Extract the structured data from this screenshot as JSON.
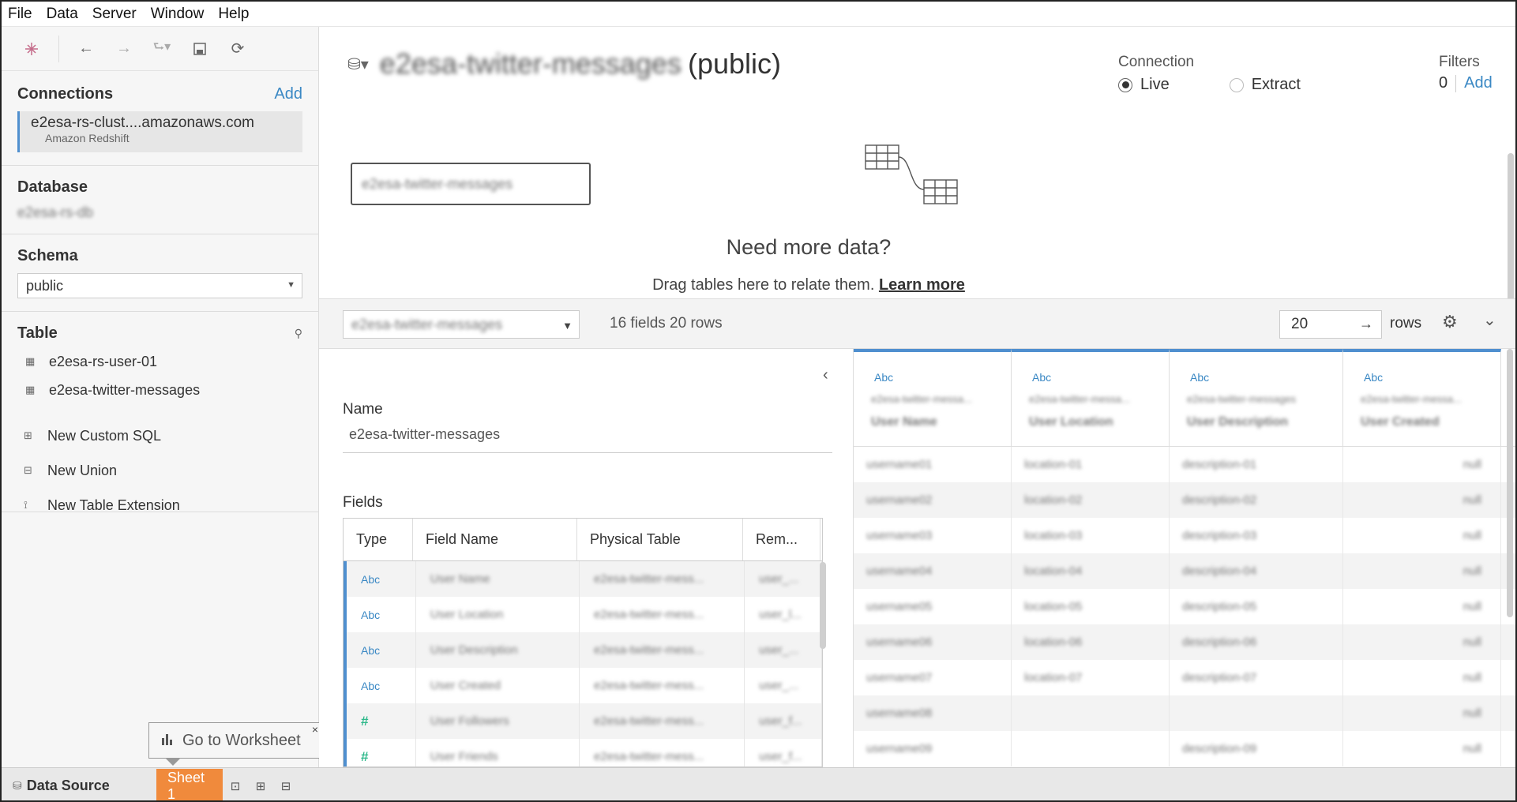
{
  "menu": [
    "File",
    "Data",
    "Server",
    "Window",
    "Help"
  ],
  "toolbar": {
    "icons": [
      "tableau-logo-icon",
      "back-icon",
      "forward-icon",
      "redo-icon",
      "save-icon",
      "refresh-icon"
    ]
  },
  "connections": {
    "title": "Connections",
    "add_label": "Add",
    "server": "e2esa-rs-clust....amazonaws.com",
    "type": "Amazon Redshift"
  },
  "database": {
    "title": "Database",
    "value": "e2esa-rs-db"
  },
  "schema": {
    "title": "Schema",
    "value": "public"
  },
  "table": {
    "title": "Table",
    "items": [
      "e2esa-rs-user-01",
      "e2esa-twitter-messages"
    ],
    "actions": [
      "New Custom SQL",
      "New Union",
      "New Table Extension"
    ]
  },
  "tooltip": {
    "label": "Go to Worksheet",
    "close": "×"
  },
  "bottom_tabs": {
    "data_source": "Data Source",
    "sheet": "Sheet 1"
  },
  "header": {
    "datasource_name": "e2esa-twitter-messages",
    "schema_suffix": "(public)",
    "connection_label": "Connection",
    "live_label": "Live",
    "extract_label": "Extract",
    "filters_label": "Filters",
    "filters_count": "0",
    "filters_add": "Add"
  },
  "canvas": {
    "table_name": "e2esa-twitter-messages",
    "need_title": "Need more data?",
    "need_sub": "Drag tables here to relate them.",
    "learn_more": "Learn more"
  },
  "midbar": {
    "selected_table": "e2esa-twitter-messages",
    "summary": "16 fields 20 rows",
    "rows_value": "20",
    "rows_label": "rows"
  },
  "metadata": {
    "name_label": "Name",
    "name_value": "e2esa-twitter-messages",
    "fields_label": "Fields",
    "columns": [
      "Type",
      "Field Name",
      "Physical Table",
      "Rem..."
    ],
    "rows": [
      {
        "type": "Abc",
        "field": "User Name",
        "table": "e2esa-twitter-mess...",
        "remote": "user_..."
      },
      {
        "type": "Abc",
        "field": "User Location",
        "table": "e2esa-twitter-mess...",
        "remote": "user_l..."
      },
      {
        "type": "Abc",
        "field": "User Description",
        "table": "e2esa-twitter-mess...",
        "remote": "user_..."
      },
      {
        "type": "Abc",
        "field": "User Created",
        "table": "e2esa-twitter-mess...",
        "remote": "user_..."
      },
      {
        "type": "#",
        "field": "User Followers",
        "table": "e2esa-twitter-mess...",
        "remote": "user_f..."
      },
      {
        "type": "#",
        "field": "User Friends",
        "table": "e2esa-twitter-mess...",
        "remote": "user_f..."
      }
    ]
  },
  "grid": {
    "columns": [
      {
        "type": "Abc",
        "table": "e2esa-twitter-messa...",
        "name": "User Name"
      },
      {
        "type": "Abc",
        "table": "e2esa-twitter-messa...",
        "name": "User Location"
      },
      {
        "type": "Abc",
        "table": "e2esa-twitter-messages",
        "name": "User Description"
      },
      {
        "type": "Abc",
        "table": "e2esa-twitter-messa...",
        "name": "User Created"
      }
    ],
    "rows": [
      [
        "username01",
        "location-01",
        "description-01",
        "null"
      ],
      [
        "username02",
        "location-02",
        "description-02",
        "null"
      ],
      [
        "username03",
        "location-03",
        "description-03",
        "null"
      ],
      [
        "username04",
        "location-04",
        "description-04",
        "null"
      ],
      [
        "username05",
        "location-05",
        "description-05",
        "null"
      ],
      [
        "username06",
        "location-06",
        "description-06",
        "null"
      ],
      [
        "username07",
        "location-07",
        "description-07",
        "null"
      ],
      [
        "username08",
        "",
        "",
        "null"
      ],
      [
        "username09",
        "",
        "description-09",
        "null"
      ]
    ]
  }
}
